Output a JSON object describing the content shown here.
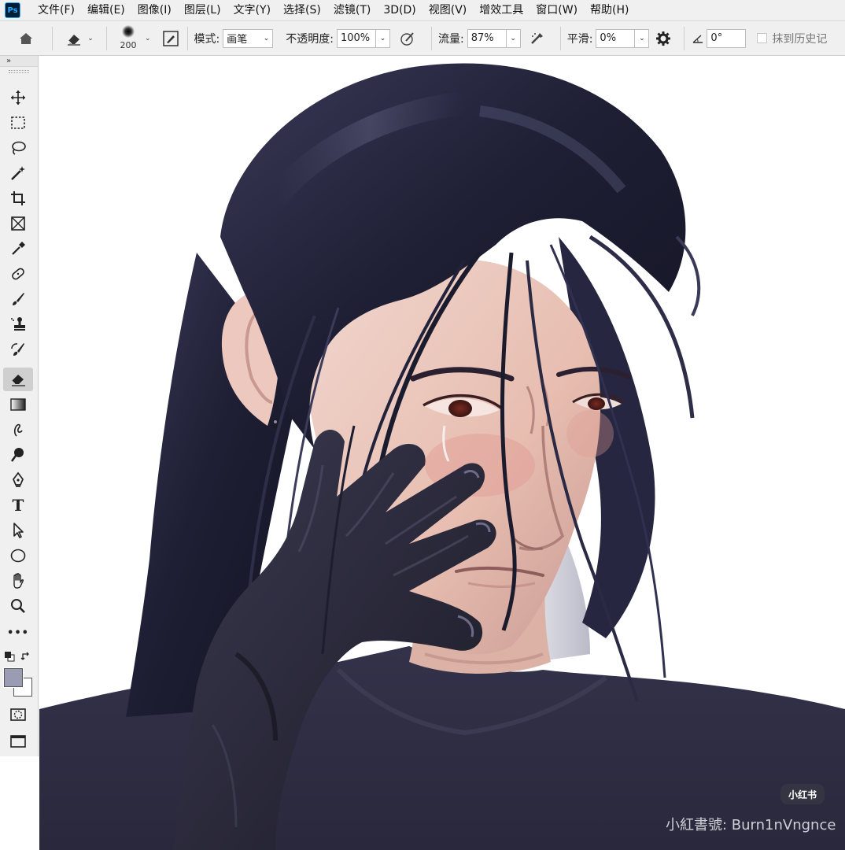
{
  "app": {
    "logo": "Ps"
  },
  "menu": [
    "文件(F)",
    "编辑(E)",
    "图像(I)",
    "图层(L)",
    "文字(Y)",
    "选择(S)",
    "滤镜(T)",
    "3D(D)",
    "视图(V)",
    "增效工具",
    "窗口(W)",
    "帮助(H)"
  ],
  "options": {
    "brush_size": "200",
    "mode_label": "模式:",
    "mode_value": "画笔",
    "opacity_label": "不透明度:",
    "opacity_value": "100%",
    "flow_label": "流量:",
    "flow_value": "87%",
    "smoothing_label": "平滑:",
    "smoothing_value": "0%",
    "angle_value": "0°",
    "erase_history_label": "抹到历史记"
  },
  "toolbox": {
    "collapse_glyph": "»",
    "active_tool": "eraser",
    "tools": [
      "move",
      "marquee",
      "lasso",
      "magic-wand",
      "crop",
      "frame",
      "eyedropper",
      "healing",
      "brush",
      "clone-stamp",
      "history-brush",
      "eraser",
      "gradient",
      "smudge",
      "dodge",
      "pen",
      "type",
      "path-select",
      "ellipse",
      "hand",
      "zoom",
      "more",
      "quickmask",
      "screen-mode"
    ],
    "type_glyph": "T",
    "more_glyph": "•••",
    "foreground_color": "#9a9cb4",
    "background_color": "#ffffff"
  },
  "colors": {
    "hair": "#1e1e33",
    "skin": "#e9c4b8",
    "glove": "#242230",
    "clothing": "#302e44"
  },
  "watermark": {
    "badge": "小红书",
    "text": "小紅書號: Burn1nVngnce"
  }
}
